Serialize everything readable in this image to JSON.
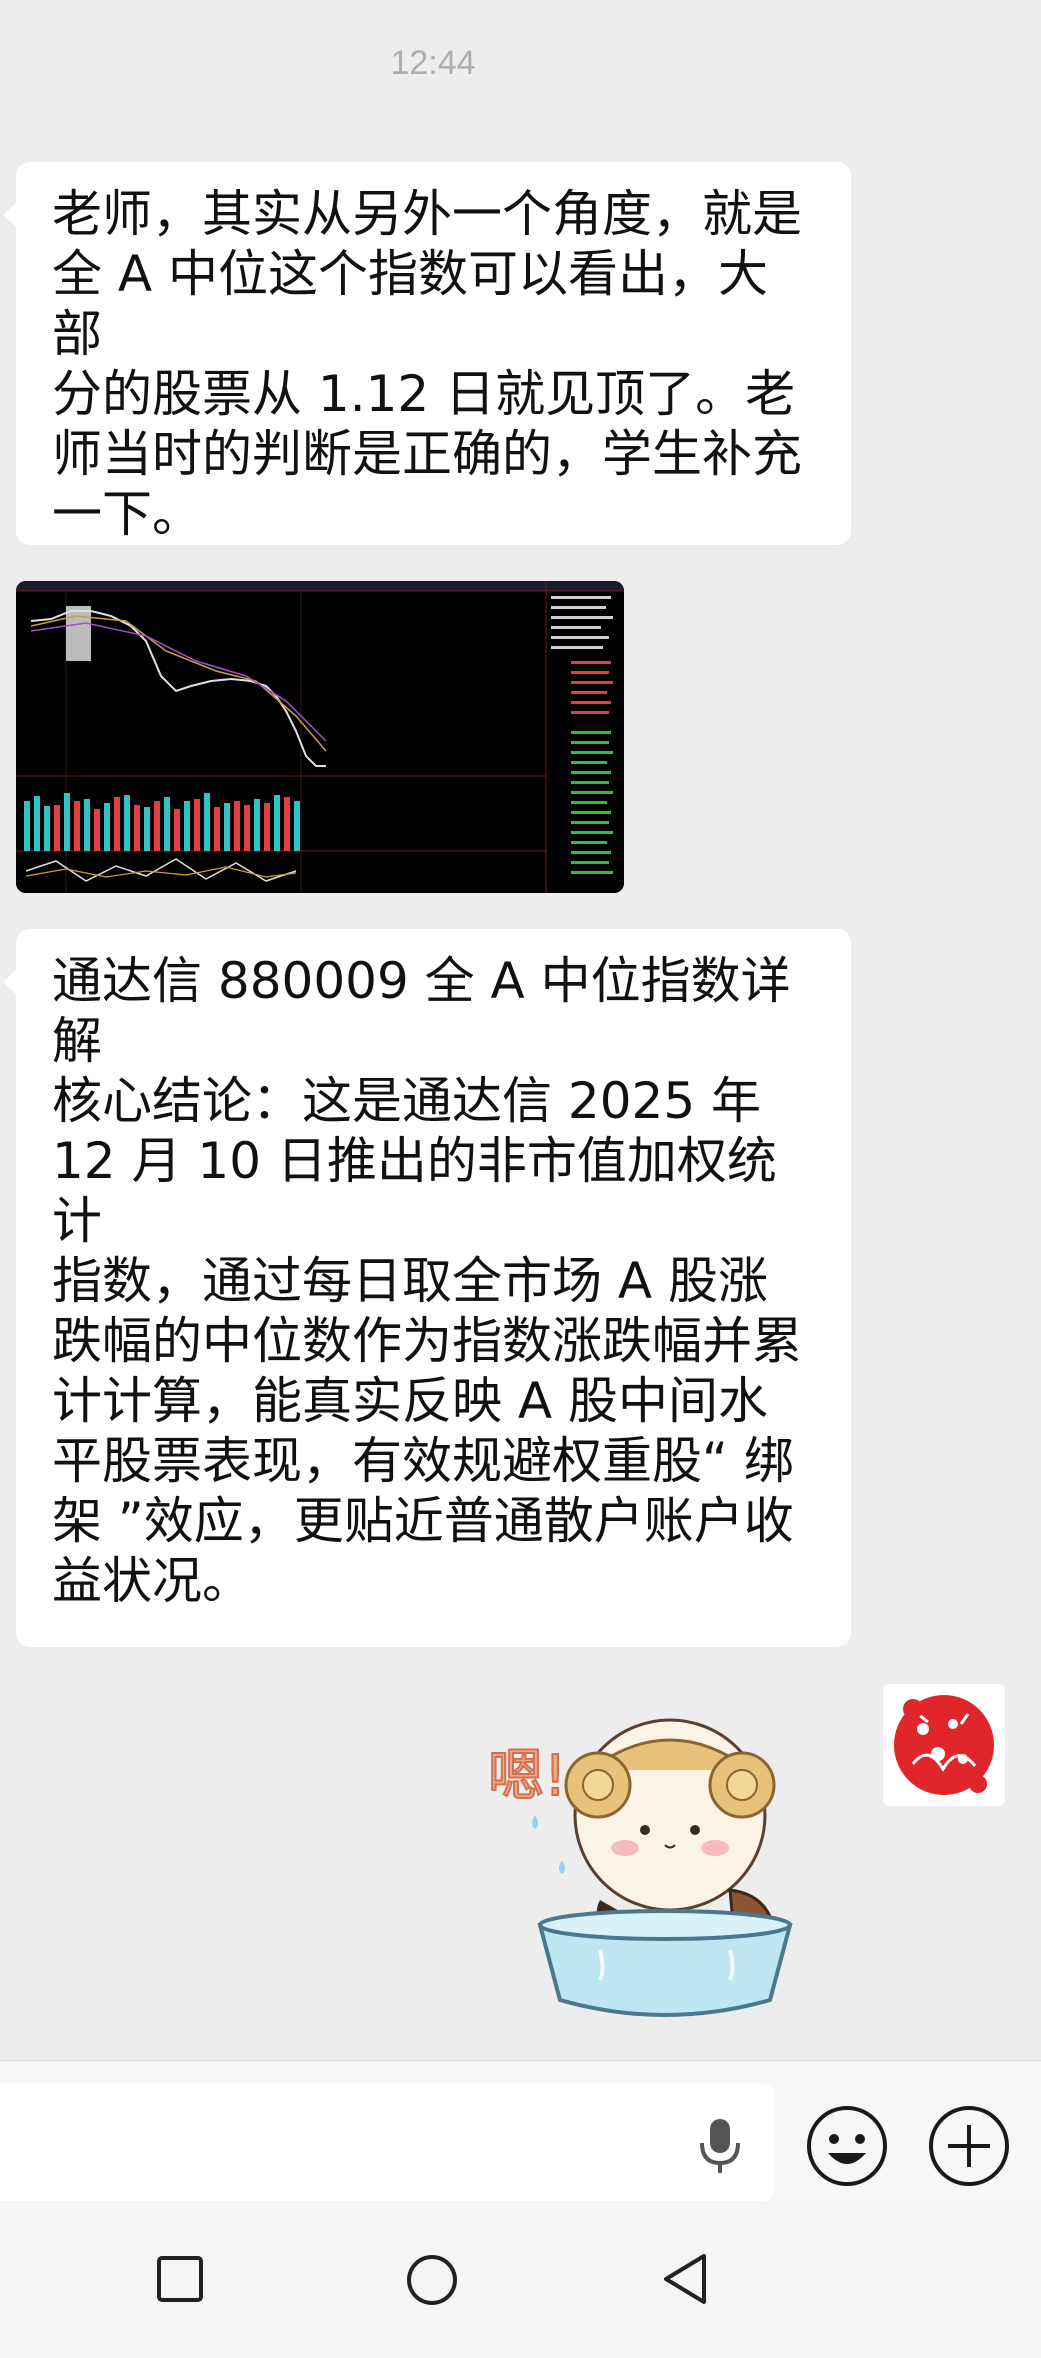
{
  "status": {
    "time": "12:44"
  },
  "messages": [
    {
      "sender": "other",
      "type": "text",
      "text": "老师，其实从另外一个角度，就是\n全 A 中位这个指数可以看出，大部\n分的股票从 1.12 日就见顶了。老\n师当时的判断是正确的，学生补充\n一下。"
    },
    {
      "sender": "other",
      "type": "image",
      "description_icon": "stock-chart-screenshot"
    },
    {
      "sender": "other",
      "type": "text",
      "text": "通达信 880009 全 A 中位指数详\n解\n核心结论：这是通达信 2025 年\n12 月 10 日推出的非市值加权统计\n指数，通过每日取全市场 A 股涨\n跌幅的中位数作为指数涨跌幅并累\n计计算，能真实反映 A 股中间水\n平股票表现，有效规避权重股“ 绑\n架 ”效应，更贴近普通散户账户收\n益状况。"
    },
    {
      "sender": "self",
      "type": "sticker",
      "sticker_text": "嗯!"
    }
  ],
  "input_bar": {
    "voice_icon": "microphone-icon",
    "emoji_icon": "emoji-icon",
    "more_icon": "plus-icon"
  },
  "nav_bar": {
    "recent_icon": "square-icon",
    "home_icon": "circle-icon",
    "back_icon": "triangle-back-icon"
  },
  "colors": {
    "background": "#ededed",
    "bubble": "#ffffff",
    "time": "#aeaeae",
    "avatar_red": "#e0262b"
  }
}
